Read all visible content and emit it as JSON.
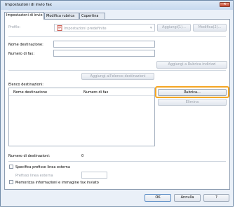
{
  "window": {
    "title": "Impostazioni di invio fax",
    "close_label": "×"
  },
  "tabs": [
    {
      "label": "Impostazioni di invio"
    },
    {
      "label": "Modifica rubrica"
    },
    {
      "label": "Copertina"
    }
  ],
  "profile": {
    "label": "Profilo:",
    "value": "Impostazioni predefinite",
    "add_button": "Aggiungi(1)...",
    "edit_button": "Modifica(2)..."
  },
  "fields": {
    "name_label": "Nome destinazione:",
    "name_value": "",
    "fax_label": "Numero di fax:",
    "fax_value": ""
  },
  "buttons": {
    "add_to_addressbook": "Aggiungi a Rubrica indirizzi",
    "add_to_list": "Aggiungi all'elenco destinazioni",
    "addressbook": "Rubrica...",
    "delete": "Elimina",
    "ok": "OK",
    "cancel": "Annulla",
    "help": "?"
  },
  "recipients": {
    "label": "Elenco destinazioni:",
    "columns": [
      "Nome destinazione",
      "Numero di fax"
    ],
    "rows": []
  },
  "count": {
    "label": "Numero di destinazioni:",
    "value": "0"
  },
  "prefix": {
    "checkbox_label": "Specifica prefisso linea esterna",
    "checked": false,
    "field_label": "Prefisso linea esterna",
    "value": ""
  },
  "store": {
    "label": "Memorizza informazioni e immagine fax inviato",
    "checked": false
  }
}
